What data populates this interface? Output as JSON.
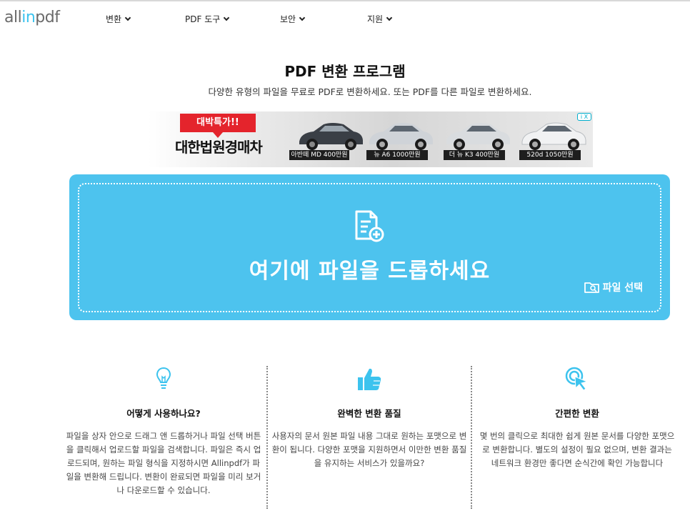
{
  "logo": {
    "part1": "all",
    "part2": "in",
    "part3": "pdf"
  },
  "nav": [
    {
      "label": "변환"
    },
    {
      "label": "PDF 도구"
    },
    {
      "label": "보안"
    },
    {
      "label": "지원"
    }
  ],
  "hero": {
    "title": "PDF 변환 프로그램",
    "subtitle": "다양한 유형의 파일을 무료로 PDF로 변환하세요. 또는 PDF를 다른 파일로 변환하세요."
  },
  "ad": {
    "tag": "대박특가!!",
    "name": "대한법원경매차",
    "badge": "i X",
    "cars": [
      {
        "label": "아반떼 MD 400만원",
        "color": "#3a3f46"
      },
      {
        "label": "뉴 A6 1000만원",
        "color": "#cfd3d8"
      },
      {
        "label": "더 뉴 K3 400만원",
        "color": "#d9dcdf"
      },
      {
        "label": "520d 1050만원",
        "color": "#f1f2f3"
      }
    ]
  },
  "dropzone": {
    "text": "여기에 파일을 드롭하세요",
    "select_label": "파일 선택",
    "color": "#4dc3ee"
  },
  "features": [
    {
      "icon": "lightbulb-icon",
      "title": "어떻게 사용하나요?",
      "body": "파일을 상자 안으로 드래그 앤 드롭하거나 파일 선택 버튼을 클릭해서 업로드할 파일을 검색합니다. 파일은 즉시 업로드되며, 원하는 파일 형식을 지정하시면 Allinpdf가 파일을 변환해 드립니다. 변환이 완료되면 파일을 미리 보거나 다운로드할 수 있습니다."
    },
    {
      "icon": "thumbs-up-icon",
      "title": "완벽한 변환 품질",
      "body": "사용자의 문서 원본 파일 내용 그대로 원하는 포맷으로 변환이 됩니다. 다양한 포맷을 지원하면서 이만한 변환 품질을 유지하는 서비스가 있을까요?"
    },
    {
      "icon": "cursor-click-icon",
      "title": "간편한 변환",
      "body": "몇 번의 클릭으로 최대한 쉽게 원본 문서를 다양한 포맷으로 변환합니다. 별도의 설정이 필요 없으며, 변환 결과는 네트워크 환경만 좋다면 순식간에 확인 가능합니다"
    }
  ],
  "accent_color": "#3cc3ee"
}
